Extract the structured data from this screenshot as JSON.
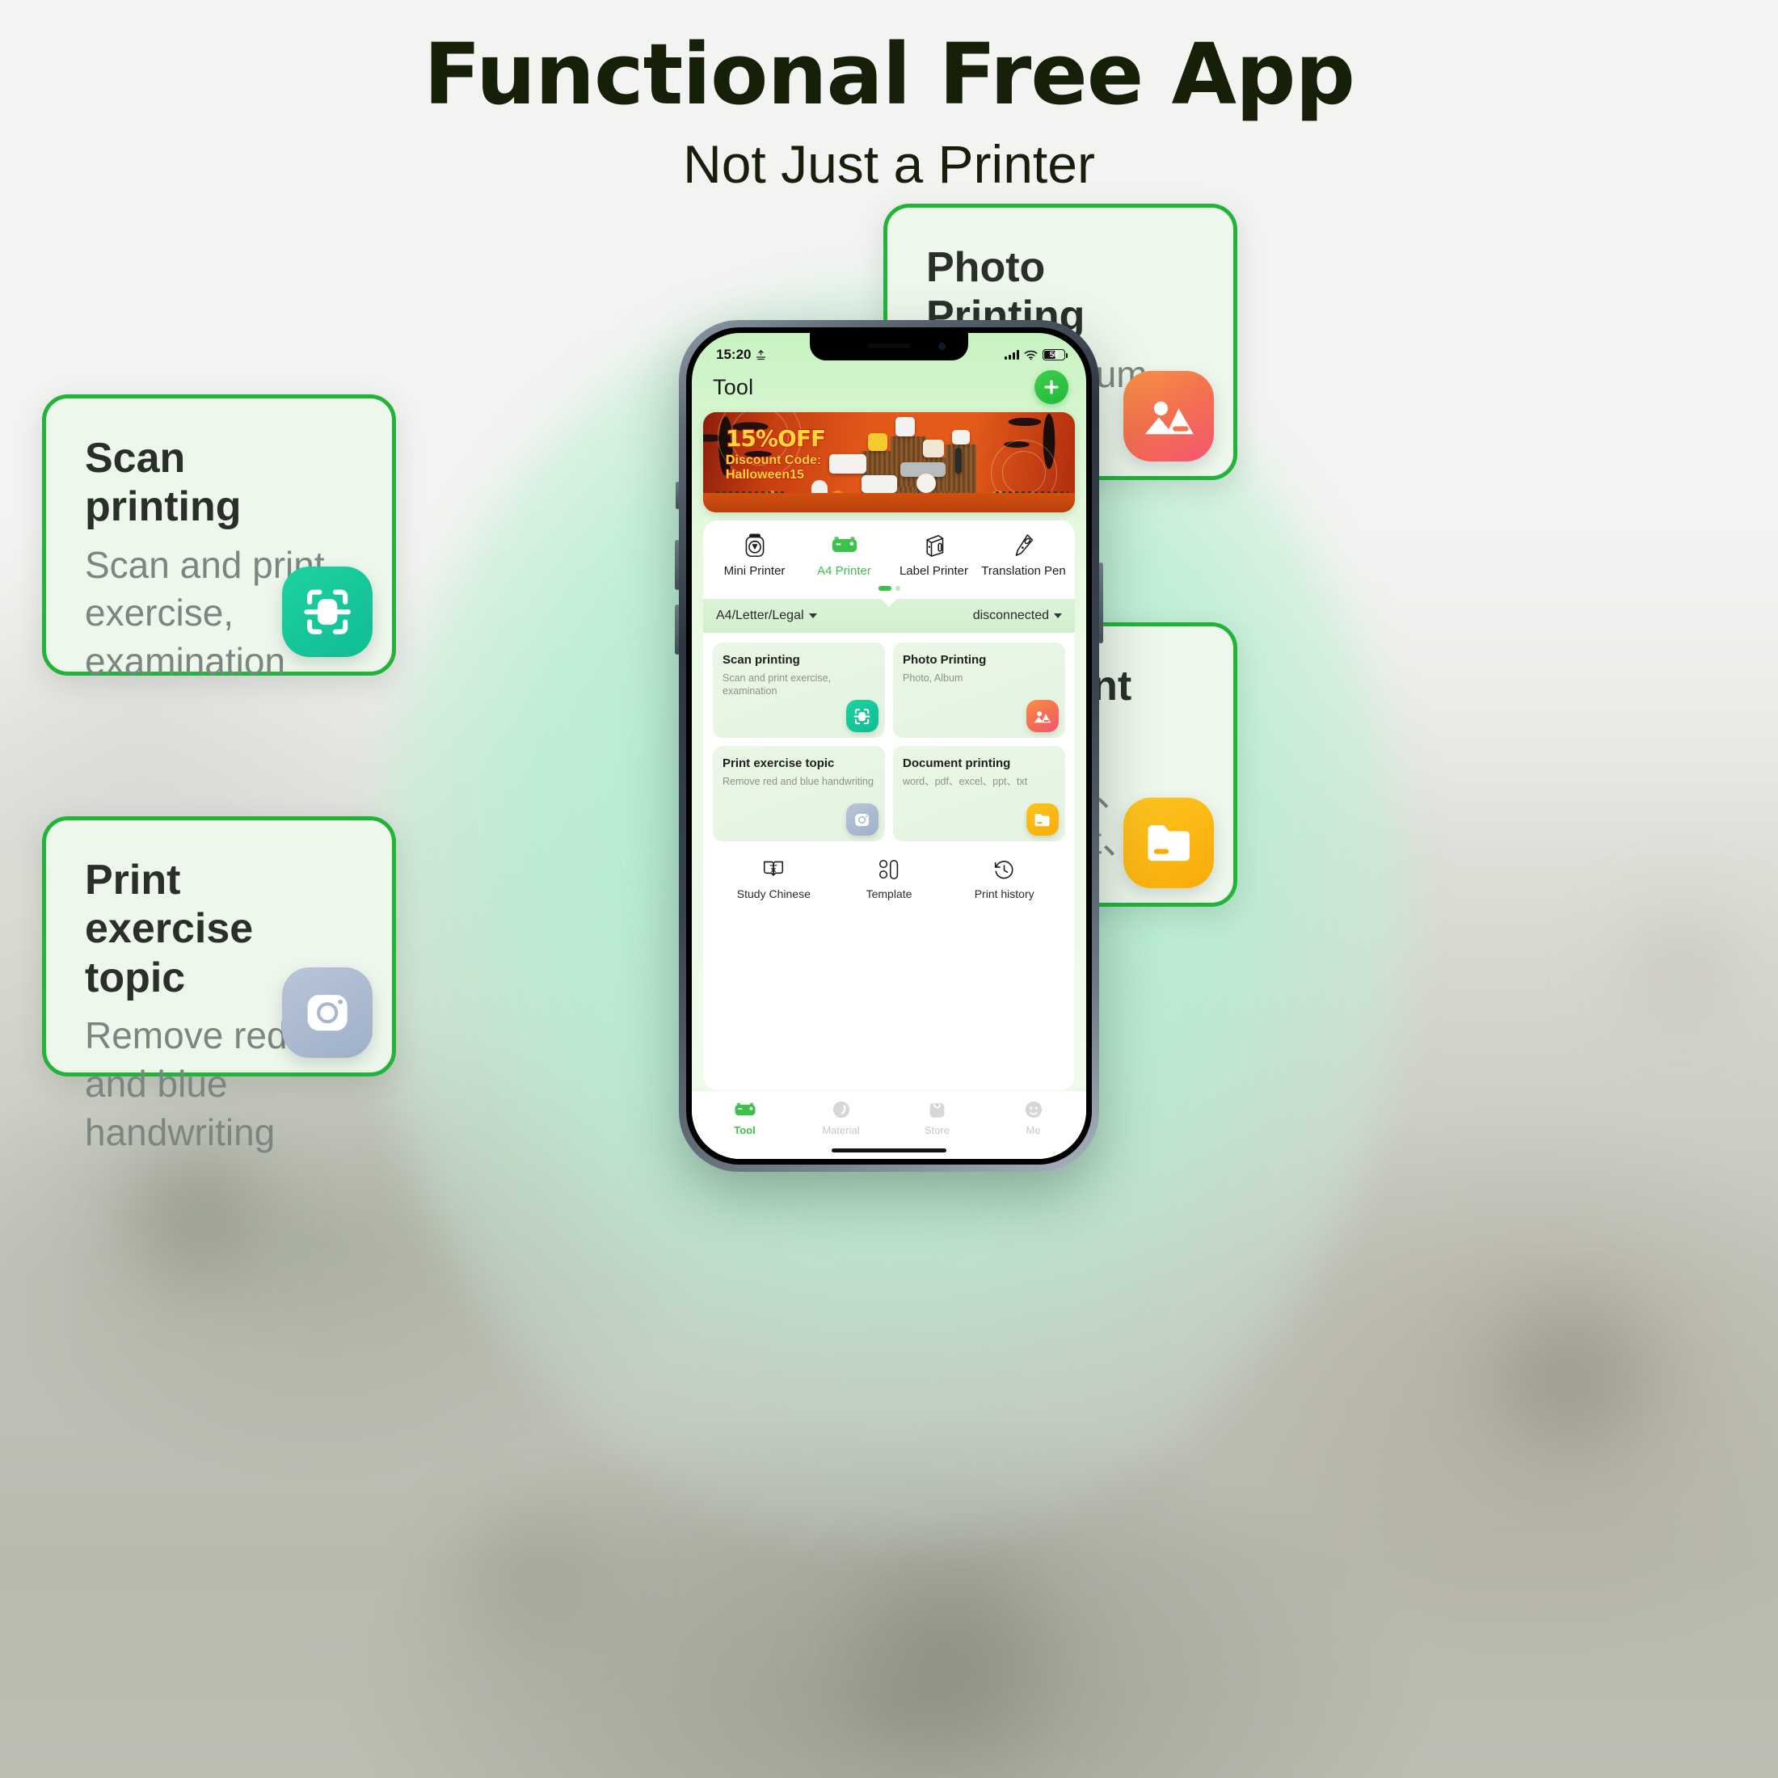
{
  "headline": {
    "title": "Functional Free App",
    "subtitle": "Not Just a Printer"
  },
  "colors": {
    "brand_green": "#22b43a",
    "accent_green": "#3ec04c",
    "card_fill": "#edf7ec",
    "scan_icon": "#16c79a",
    "photo_icon": "#f4724f",
    "camera_icon": "#a9b8cd",
    "folder_icon": "#fbb812",
    "title_color": "#161f08"
  },
  "callouts": [
    {
      "id": "scan-printing",
      "title": "Scan printing",
      "description": "Scan and print exercise, examination",
      "icon": "scan-icon"
    },
    {
      "id": "print-exercise-topic",
      "title": "Print exercise topic",
      "description": "Remove red and blue handwriting",
      "icon": "camera-icon"
    },
    {
      "id": "photo-printing",
      "title": "Photo Printing",
      "description": "Photo, Album",
      "icon": "photo-icon"
    },
    {
      "id": "document-printing",
      "title": "Document printing",
      "description": "word、pdf、excel、ppt、txt",
      "icon": "folder-icon"
    }
  ],
  "phone": {
    "status_bar": {
      "time": "15:20",
      "location_icon": "location-arrow-icon",
      "signal_icon": "cellular-bars-icon",
      "wifi_icon": "wifi-icon",
      "battery_level": "50",
      "battery_icon": "battery-icon"
    },
    "nav": {
      "title": "Tool",
      "add_button_icon": "plus-icon"
    },
    "banner": {
      "discount": "15%OFF",
      "code_label": "Discount Code:",
      "code_value": "Halloween15"
    },
    "printer_types": [
      {
        "label": "Mini Printer",
        "icon": "mini-printer-icon",
        "active": false
      },
      {
        "label": "A4 Printer",
        "icon": "a4-printer-icon",
        "active": true
      },
      {
        "label": "Label Printer",
        "icon": "label-printer-icon",
        "active": false
      },
      {
        "label": "Translation Pen",
        "icon": "translation-pen-icon",
        "active": false
      }
    ],
    "pagination": {
      "total": 2,
      "current": 1
    },
    "status_strip": {
      "paper_size": "A4/Letter/Legal",
      "paper_size_icon": "chevron-down-icon",
      "connection": "disconnected",
      "connection_icon": "chevron-down-icon"
    },
    "features": [
      {
        "title": "Scan printing",
        "desc": "Scan and print exercise, examination",
        "icon": "scan-icon"
      },
      {
        "title": "Photo Printing",
        "desc": "Photo, Album",
        "icon": "photo-icon"
      },
      {
        "title": "Print exercise topic",
        "desc": "Remove red and blue handwriting",
        "icon": "camera-icon"
      },
      {
        "title": "Document printing",
        "desc": "word、pdf、excel、ppt、txt",
        "icon": "folder-icon"
      }
    ],
    "tools": [
      {
        "label": "Study Chinese",
        "icon": "book-chinese-icon"
      },
      {
        "label": "Template",
        "icon": "template-grid-icon"
      },
      {
        "label": "Print history",
        "icon": "history-clock-icon"
      }
    ],
    "tabs": [
      {
        "label": "Tool",
        "icon": "printer-icon",
        "active": true
      },
      {
        "label": "Material",
        "icon": "material-circle-icon",
        "active": false
      },
      {
        "label": "Store",
        "icon": "shopping-bag-icon",
        "active": false
      },
      {
        "label": "Me",
        "icon": "profile-icon",
        "active": false
      }
    ]
  }
}
